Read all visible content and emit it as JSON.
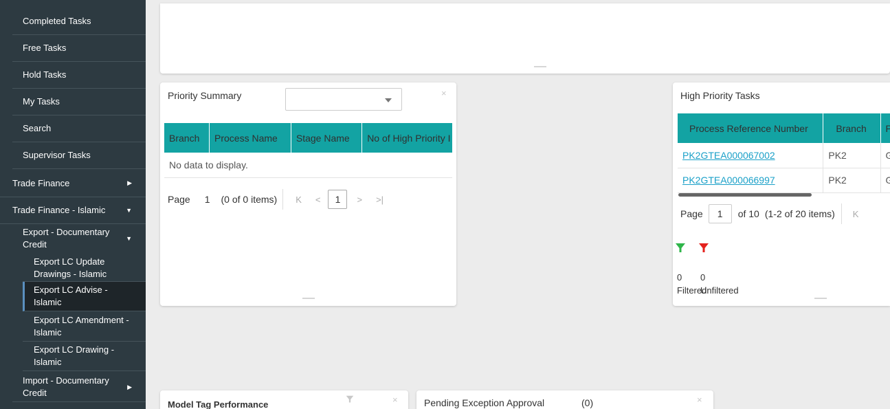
{
  "sidebar": {
    "items": [
      {
        "label": "Completed Tasks"
      },
      {
        "label": "Free Tasks"
      },
      {
        "label": "Hold Tasks"
      },
      {
        "label": "My Tasks"
      },
      {
        "label": "Search"
      },
      {
        "label": "Supervisor Tasks"
      },
      {
        "label": "Trade Finance"
      },
      {
        "label": "Trade Finance - Islamic"
      },
      {
        "label": "Export - Documentary Credit"
      },
      {
        "label": "Export LC Update Drawings - Islamic"
      },
      {
        "label": "Export LC Advise - Islamic"
      },
      {
        "label": "Export LC Amendment - Islamic"
      },
      {
        "label": "Export LC Drawing - Islamic"
      },
      {
        "label": "Import - Documentary Credit"
      }
    ]
  },
  "priority_summary": {
    "title": "Priority Summary",
    "close": "×",
    "columns": [
      "Branch",
      "Process Name",
      "Stage Name",
      "No of High Priority I"
    ],
    "empty_text": "No data to display.",
    "pager": {
      "page_label": "Page",
      "page": "1",
      "items": "(0 of 0 items)",
      "current": "1"
    }
  },
  "high_priority": {
    "title": "High Priority Tasks",
    "columns": [
      "Process Reference Number",
      "Branch",
      "P"
    ],
    "rows": [
      {
        "ref": "PK2GTEA000067002",
        "branch": "PK2",
        "p": "Gu"
      },
      {
        "ref": "PK2GTEA000066997",
        "branch": "PK2",
        "p": "Gu"
      }
    ],
    "pager": {
      "page_label": "Page",
      "page": "1",
      "of": "of 10",
      "items": "(1-2 of 20 items)"
    },
    "filtered": {
      "count": "0",
      "label": "Filtered"
    },
    "unfiltered": {
      "count": "0",
      "label": "Unfiltered"
    },
    "colors": {
      "filtered": "#2fb54a",
      "unfiltered": "#e4221e"
    }
  },
  "model_tag": {
    "title": "Model Tag Performance",
    "close": "×"
  },
  "pending_exception": {
    "title": "Pending Exception Approval",
    "count": "(0)",
    "close": "×"
  },
  "nav": {
    "first": "K",
    "prev": "<",
    "next": ">",
    "last": ">|"
  },
  "colors": {
    "sidebar_bg": "#2d3a41",
    "header_teal": "#13a3a3",
    "link": "#1aa0c8"
  }
}
